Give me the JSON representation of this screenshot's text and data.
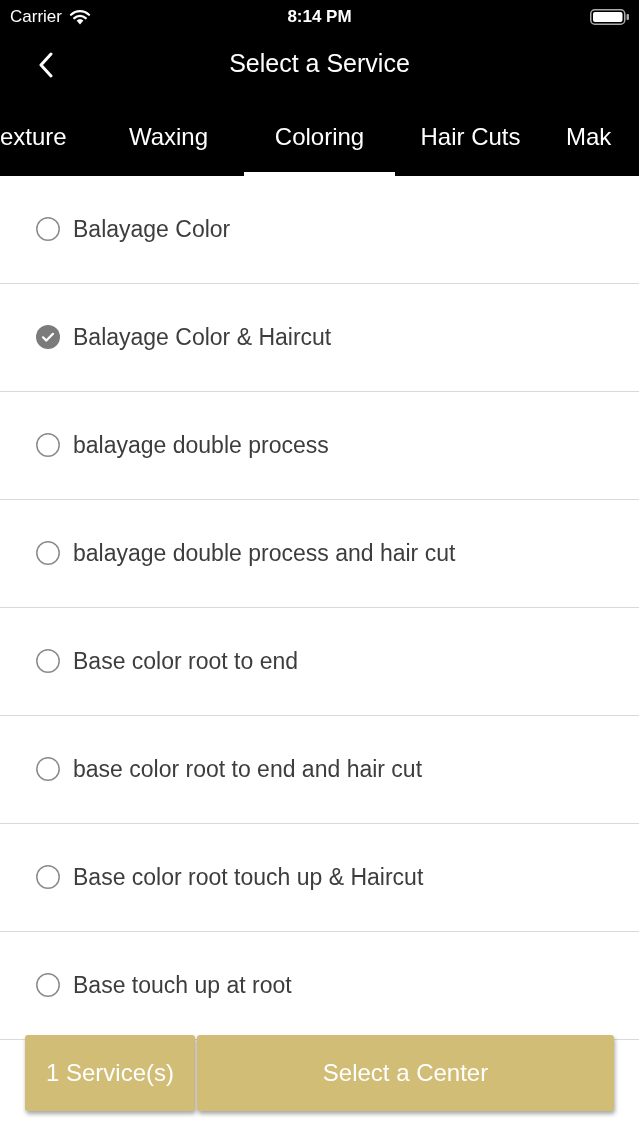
{
  "status_bar": {
    "carrier": "Carrier",
    "time": "8:14 PM"
  },
  "nav": {
    "title": "Select a Service"
  },
  "tabs": [
    {
      "label": "exture",
      "selected": false
    },
    {
      "label": "Waxing",
      "selected": false
    },
    {
      "label": "Coloring",
      "selected": true
    },
    {
      "label": "Hair Cuts",
      "selected": false
    },
    {
      "label": "Mak",
      "selected": false
    }
  ],
  "services": [
    {
      "name": "Balayage Color",
      "selected": false
    },
    {
      "name": "Balayage Color & Haircut",
      "selected": true
    },
    {
      "name": "balayage double process",
      "selected": false
    },
    {
      "name": "balayage double process and hair cut",
      "selected": false
    },
    {
      "name": "Base color root to end",
      "selected": false
    },
    {
      "name": "base color root to end and hair cut",
      "selected": false
    },
    {
      "name": "Base color root touch up & Haircut",
      "selected": false
    },
    {
      "name": "Base touch up at root",
      "selected": false
    }
  ],
  "footer": {
    "count": "1 Service(s)",
    "action": "Select a Center"
  }
}
